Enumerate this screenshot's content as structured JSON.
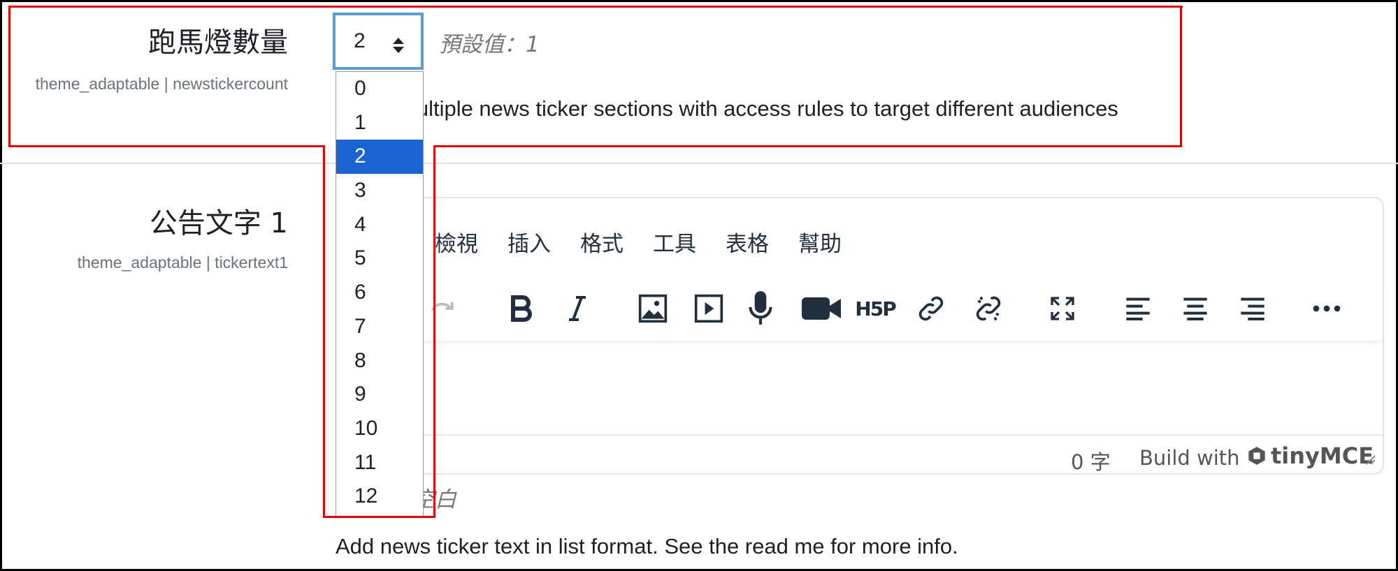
{
  "newsticker_count": {
    "title": "跑馬燈數量",
    "setting_key": "theme_adaptable | newstickercount",
    "selected_value": "2",
    "default_text": "預設值：1",
    "description": "multiple news ticker sections with access rules to target different audiences",
    "options": [
      "0",
      "1",
      "2",
      "3",
      "4",
      "5",
      "6",
      "7",
      "8",
      "9",
      "10",
      "11",
      "12"
    ]
  },
  "ticker_text": {
    "title": "公告文字 1",
    "setting_key": "theme_adaptable | tickertext1",
    "menubar": [
      "檢視",
      "插入",
      "格式",
      "工具",
      "表格",
      "幫助"
    ],
    "toolbar_icons": [
      "redo-icon",
      "bold-icon",
      "italic-icon",
      "image-icon",
      "media-icon",
      "microphone-icon",
      "video-icon",
      "h5p-icon",
      "link-icon",
      "unlink-icon",
      "fullscreen-icon",
      "align-left-icon",
      "align-center-icon",
      "align-right-icon",
      "more-icon"
    ],
    "word_count": "0 字",
    "build_with": "Build with",
    "brand_name": "tinyMCE",
    "default_text": "：空白",
    "description": "Add news ticker text in list format. See the read me for more info."
  },
  "colors": {
    "highlight": "#e00000",
    "selected_option": "#1a63d1",
    "focus_border": "#5b9bd5"
  }
}
